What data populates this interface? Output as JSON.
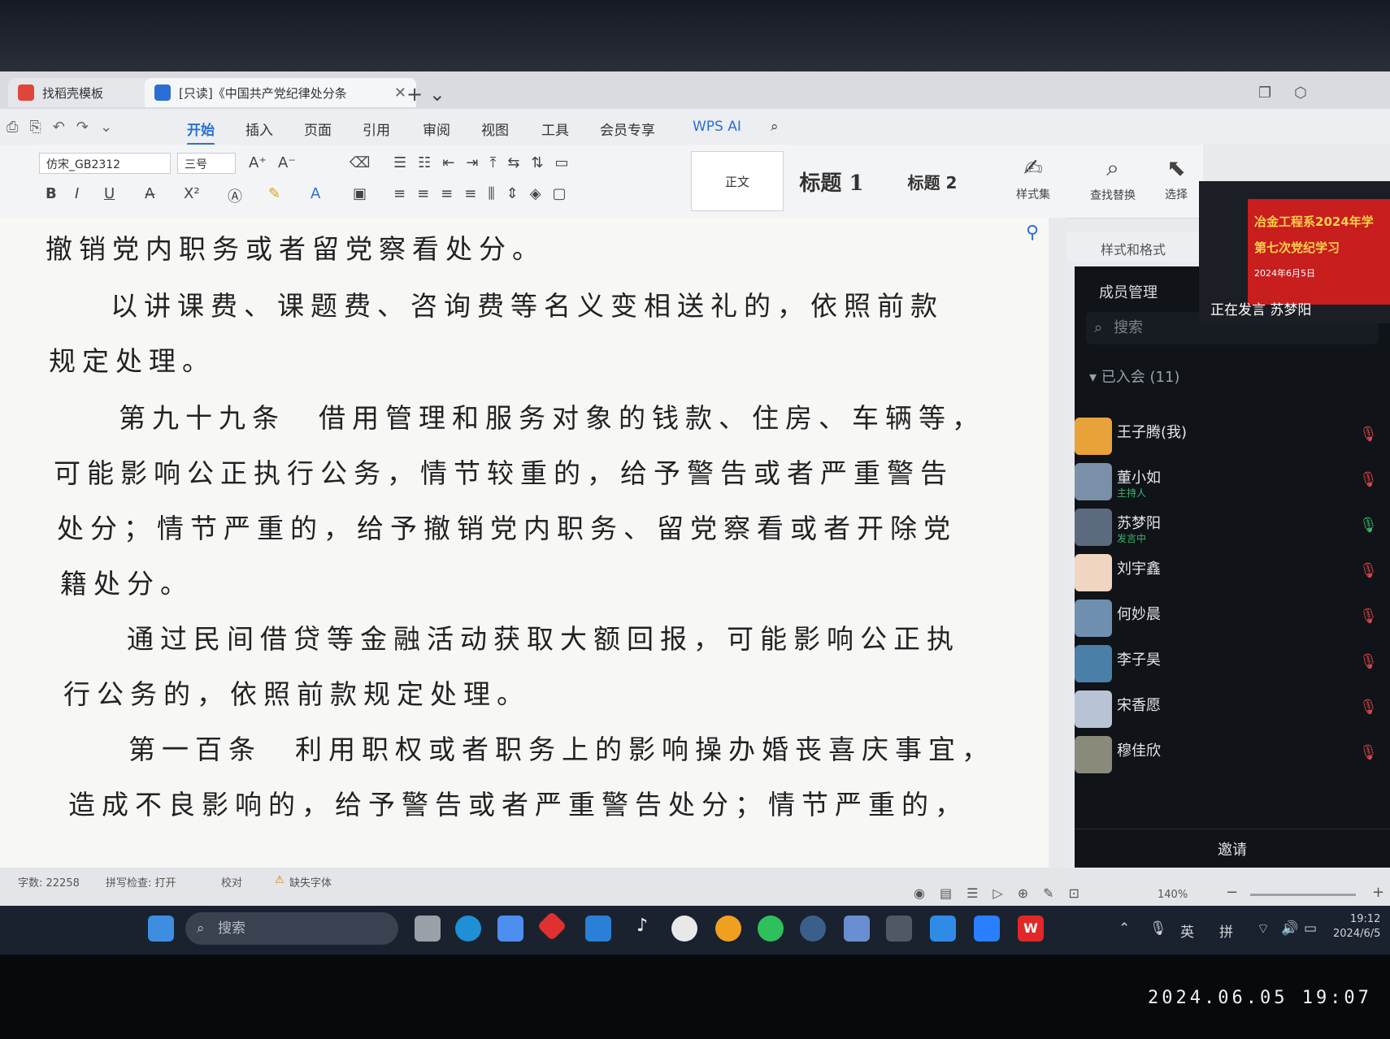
{
  "tabs": [
    {
      "label": "找稻壳模板"
    },
    {
      "label": "[只读]《中国共产党纪律处分条"
    }
  ],
  "menu": [
    "开始",
    "插入",
    "页面",
    "引用",
    "审阅",
    "视图",
    "工具",
    "会员专享",
    "WPS AI"
  ],
  "toolbar": {
    "font_name": "仿宋_GB2312",
    "font_size": "三号",
    "style_normal": "正文",
    "style_h1": "标题 1",
    "style_h2": "标题 2",
    "styles_set": "样式集",
    "find_replace": "查找替换",
    "select": "选择"
  },
  "document": {
    "lines": [
      "撤销党内职务或者留党察看处分。",
      "以讲课费、课题费、咨询费等名义变相送礼的，依照前款",
      "规定处理。",
      "第九十九条　借用管理和服务对象的钱款、住房、车辆等，",
      "可能影响公正执行公务，情节较重的，给予警告或者严重警告",
      "处分；情节严重的，给予撤销党内职务、留党察看或者开除党",
      "籍处分。",
      "通过民间借贷等金融活动获取大额回报，可能影响公正执",
      "行公务的，依照前款规定处理。",
      "第一百条　利用职权或者职务上的影响操办婚丧喜庆事宜，",
      "造成不良影响的，给予警告或者严重警告处分；情节严重的，"
    ]
  },
  "styles_pane": {
    "title": "样式和格式"
  },
  "meeting": {
    "panel_title": "成员管理",
    "search_placeholder": "搜索",
    "group_label": "已入会 (11)",
    "members": [
      {
        "name": "王子腾(我)",
        "role": "",
        "mic": "muted",
        "color": "#e8a23a"
      },
      {
        "name": "董小如",
        "role": "主持人",
        "mic": "muted",
        "color": "#7a8fa8"
      },
      {
        "name": "苏梦阳",
        "role": "发言中",
        "mic": "on",
        "color": "#5c6a80"
      },
      {
        "name": "刘宇鑫",
        "role": "",
        "mic": "muted",
        "color": "#f0d6c0"
      },
      {
        "name": "何妙晨",
        "role": "",
        "mic": "muted",
        "color": "#6f8fb0"
      },
      {
        "name": "李子昊",
        "role": "",
        "mic": "muted",
        "color": "#4a7fa8"
      },
      {
        "name": "宋香愿",
        "role": "",
        "mic": "muted",
        "color": "#b8c4d6"
      },
      {
        "name": "穆佳欣",
        "role": "",
        "mic": "muted",
        "color": "#8a8a7a"
      }
    ],
    "invite_label": "邀请",
    "video": {
      "banner_line1": "冶金工程系2024年学",
      "banner_line2": "第七次党纪学习",
      "banner_date": "2024年6月5日",
      "speaking_label": "正在发言 苏梦阳"
    }
  },
  "statusbar": {
    "word_count": "字数: 22258",
    "spell_check": "拼写检查: 打开",
    "proofread": "校对",
    "missing_font": "缺失字体",
    "zoom": "140%"
  },
  "taskbar": {
    "search_placeholder": "搜索",
    "ime_lang": "英",
    "ime_mode": "拼",
    "time": "19:12",
    "date": "2024/6/5"
  },
  "photo_timestamp": "2024.06.05 19:07"
}
